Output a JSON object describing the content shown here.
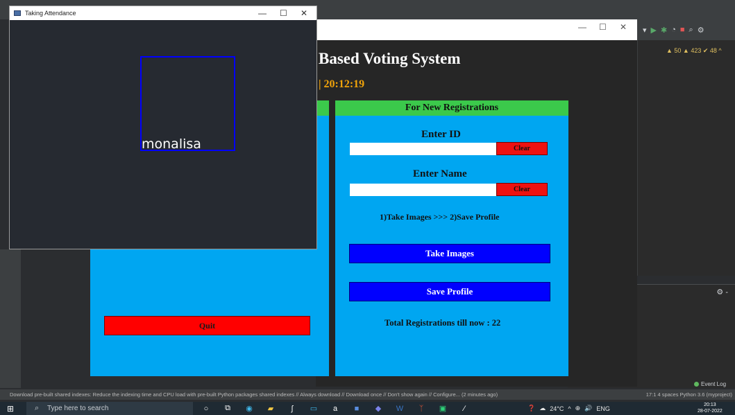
{
  "ide": {
    "toolbar_icons": [
      "dropdown-icon",
      "run-icon",
      "debug-icon",
      "coverage-icon",
      "stop-icon",
      "search-icon",
      "settings-icon"
    ],
    "inspections": "▲ 50  ▲ 423  ✔ 48  ^",
    "event_log": "Event Log",
    "status_message": "Download pre-built shared indexes: Reduce the indexing time and CPU load with pre-built Python packages shared indexes // Always download // Download once // Don't show again // Configure... (2 minutes ago)",
    "status_right": "17:1   4 spaces   Python 3.6 (myproject)"
  },
  "taskbar": {
    "search_placeholder": "Type here to search",
    "weather": "24°C",
    "language": "ENG",
    "time": "20:13",
    "date": "28-07-2022"
  },
  "app": {
    "title": "Based Voting System",
    "datetime": "2  |  20:12:19",
    "quit_label": "Quit",
    "new_reg_header": "For New Registrations",
    "enter_id_label": "Enter ID",
    "id_value": "",
    "clear_label": "Clear",
    "enter_name_label": "Enter Name",
    "name_value": "",
    "steps_text": "1)Take Images  >>>  2)Save Profile",
    "take_images_label": "Take Images",
    "save_profile_label": "Save Profile",
    "total_registrations": "Total Registrations till now  : 22"
  },
  "camera": {
    "window_title": "Taking Attendance",
    "recognized_name": "monalisa"
  },
  "colors": {
    "panel_blue": "#00a6f1",
    "header_green": "#3bc94b",
    "button_blue": "#0000ff",
    "button_red": "#ff0000",
    "clock_orange": "#f0a30a"
  }
}
